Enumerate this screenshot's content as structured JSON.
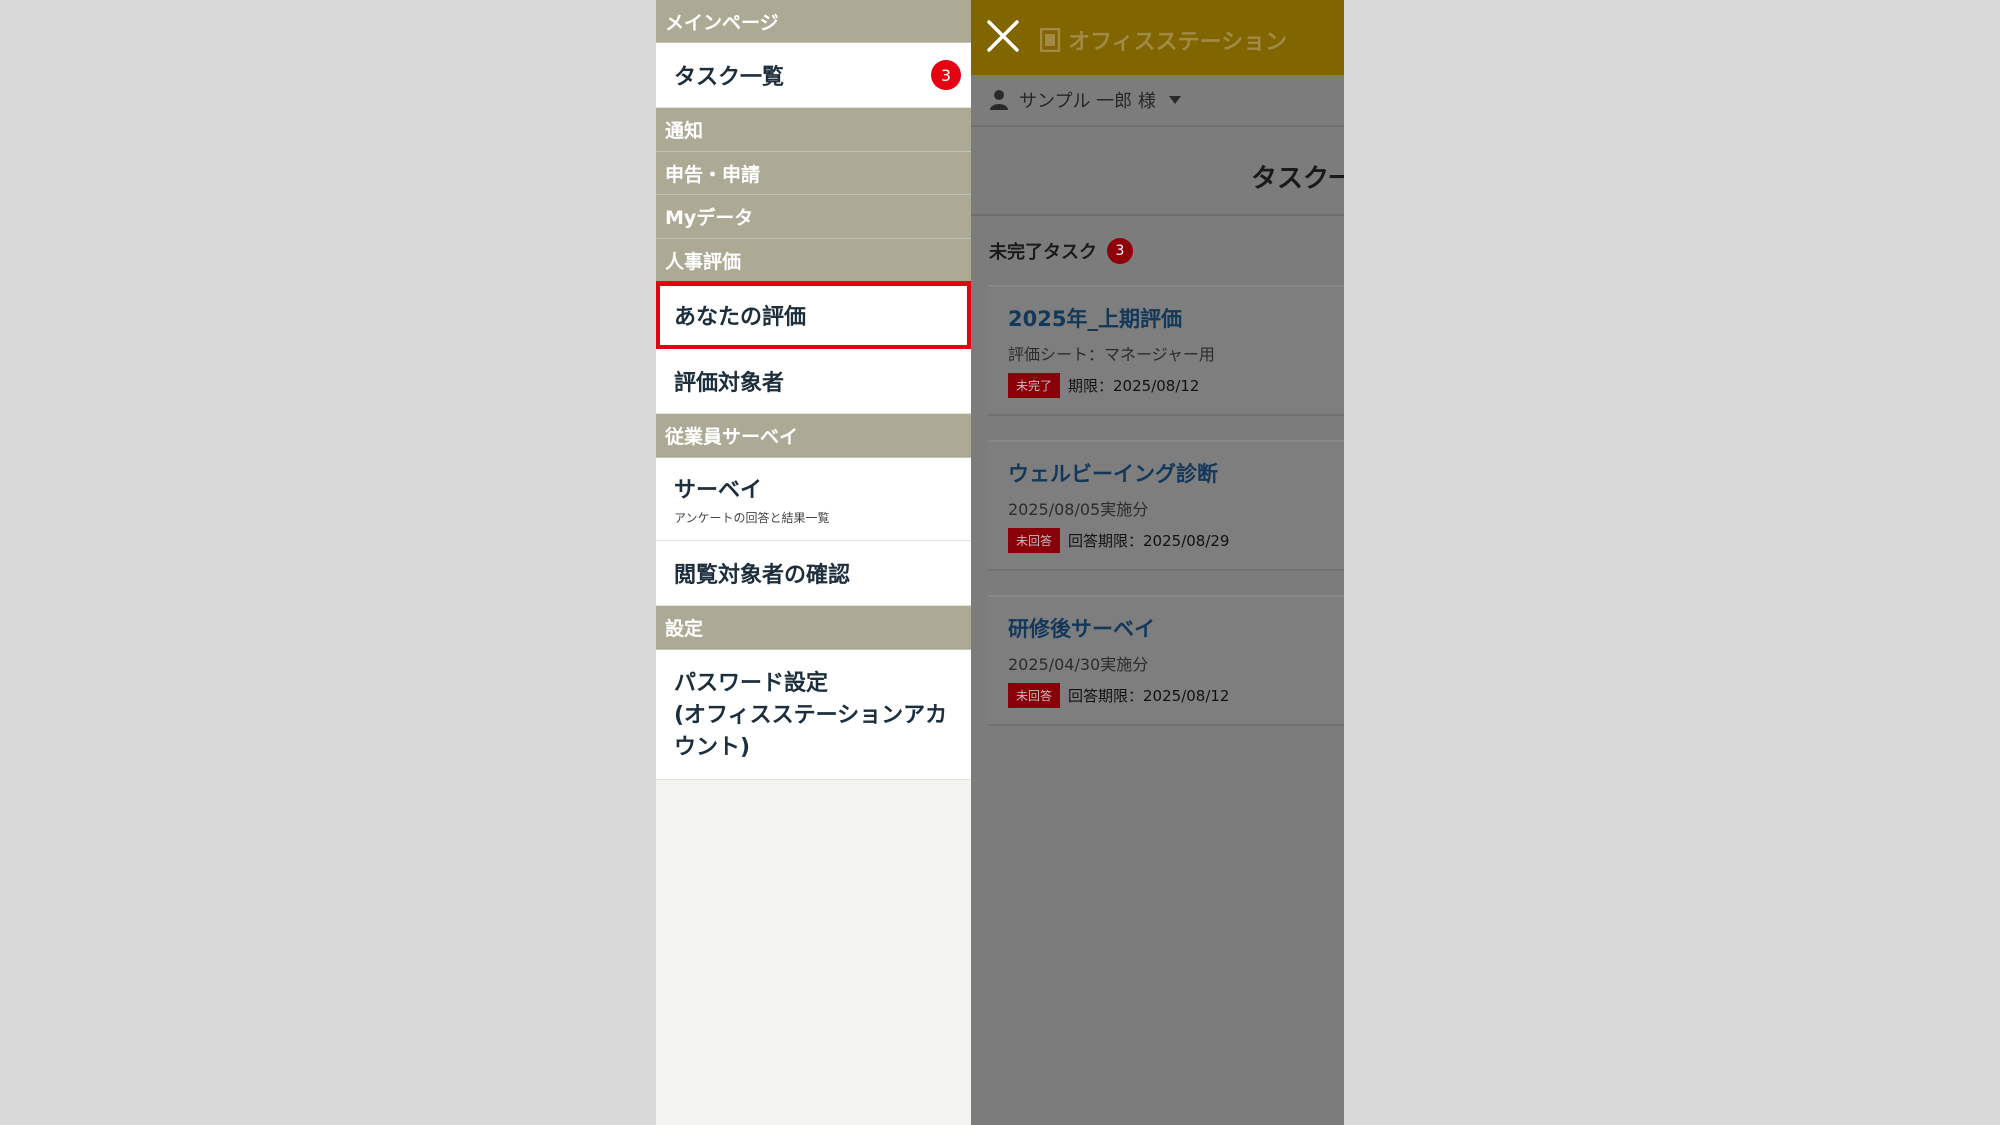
{
  "drawer": {
    "sections": [
      {
        "header": "メインページ",
        "items": [
          {
            "label": "タスク一覧",
            "badge": "3"
          }
        ]
      },
      {
        "header": "通知"
      },
      {
        "header": "申告・申請"
      },
      {
        "header": "Myデータ"
      },
      {
        "header": "人事評価",
        "items": [
          {
            "label": "あなたの評価",
            "highlighted": true
          },
          {
            "label": "評価対象者"
          }
        ]
      },
      {
        "header": "従業員サーベイ",
        "items": [
          {
            "label": "サーベイ",
            "sublabel": "アンケートの回答と結果一覧"
          },
          {
            "label": "閲覧対象者の確認"
          }
        ]
      },
      {
        "header": "設定",
        "items": [
          {
            "label_lines": [
              "パスワード設定",
              "(オフィスステーションアカ",
              "ウント)"
            ]
          }
        ]
      }
    ]
  },
  "main": {
    "brand": "オフィスステーション",
    "user": "サンプル 一郎 様",
    "page_title": "タスク一覧",
    "tasks_heading": "未完了タスク",
    "tasks_count": "3",
    "tasks": [
      {
        "title": "2025年_上期評価",
        "subtitle": "評価シート：マネージャー用",
        "status": "未完了",
        "deadline": "期限：2025/08/12"
      },
      {
        "title": "ウェルビーイング診断",
        "subtitle": "2025/08/05実施分",
        "status": "未回答",
        "deadline": "回答期限：2025/08/29"
      },
      {
        "title": "研修後サーベイ",
        "subtitle": "2025/04/30実施分",
        "status": "未回答",
        "deadline": "回答期限：2025/08/12"
      }
    ]
  },
  "colors": {
    "drawer_header_bg": "#acaa95",
    "highlight_outline": "#e60012",
    "badge": "#e60012",
    "topbar": "#806500",
    "overlay": "#7c7c7c"
  },
  "icons": {
    "close": "close-icon",
    "brand": "office-station-logo-icon",
    "user": "user-icon",
    "dropdown": "caret-down-icon"
  }
}
